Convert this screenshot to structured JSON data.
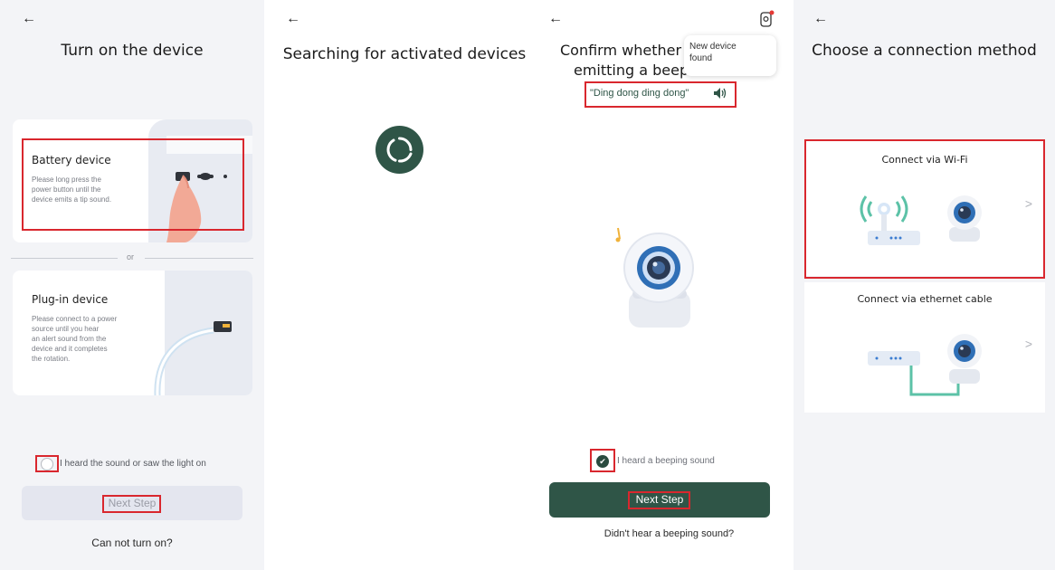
{
  "screens": {
    "turn_on": {
      "back_icon": "←",
      "title": "Turn on the device",
      "battery": {
        "title": "Battery device",
        "desc": [
          "Please long press the",
          "power button until the",
          "device emits a tip sound."
        ]
      },
      "divider_text": "or",
      "plugin": {
        "title": "Plug-in device",
        "desc": [
          "Please connect to a power",
          "source until you hear",
          "an alert sound from the",
          "device and it completes",
          "the rotation."
        ]
      },
      "confirm_label": "I heard the sound or saw the light on",
      "next_label": "Next Step",
      "help_link": "Can not turn on?"
    },
    "searching": {
      "back_icon": "←",
      "title": "Searching for activated devices",
      "spinner_color": "#2f5547"
    },
    "confirm_beep": {
      "back_icon": "←",
      "title_line1": "Confirm whether th",
      "title_line2": "emitting a beepi",
      "toast_line1": "New device",
      "toast_line2": "found",
      "sound_text": "\"Ding dong ding dong\"",
      "checkbox_label": "I heard a beeping sound",
      "next_label": "Next Step",
      "help_link": "Didn't hear a beeping sound?",
      "accent_color": "#2f5547"
    },
    "connection": {
      "back_icon": "←",
      "title": "Choose a connection method",
      "wifi_label": "Connect via Wi-Fi",
      "ethernet_label": "Connect via ethernet cable",
      "chevron": ">"
    }
  },
  "colors": {
    "highlight": "#d9272e",
    "brand": "#2f5547",
    "panel_bg": "#f3f4f7"
  }
}
